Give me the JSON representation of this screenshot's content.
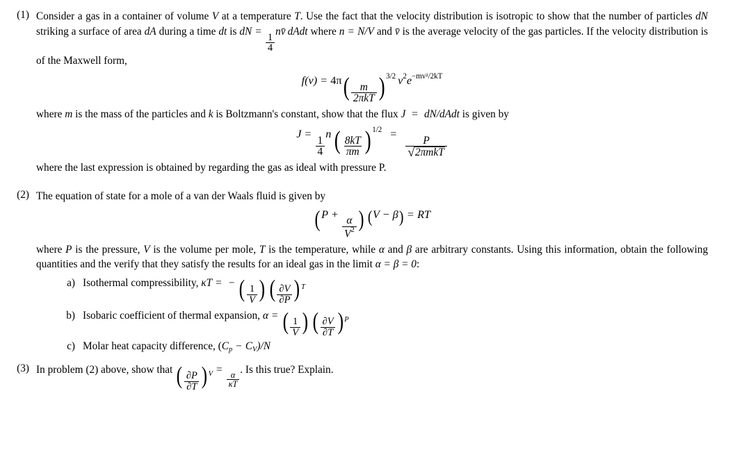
{
  "document": {
    "type": "physics-problem-set",
    "background_color": "#ffffff",
    "text_color": "#000000"
  },
  "problems": [
    {
      "number": "(1)",
      "paragraph1_part1": "Consider a gas in a container of volume",
      "v_symbol": "V",
      "paragraph1_part2": "at a temperature",
      "t_symbol": "T",
      "paragraph1_part3": ". Use the fact that the velocity distribution is isotropic to show that the number of particles",
      "dn_symbol": "dN",
      "paragraph1_part4": "striking a surface of area",
      "da_symbol": "dA",
      "paragraph1_part5": "during a time",
      "dt_symbol": "dt",
      "paragraph1_part6": "is",
      "eq_dn_lhs": "dN",
      "eq_dn_frac_num": "1",
      "eq_dn_frac_den": "4",
      "eq_dn_rhs": "n",
      "eq_dn_vbar": "v̄",
      "eq_dn_tail": "dAdt",
      "paragraph1_part7": "where",
      "n_symbol": "n",
      "n_value": "N/V",
      "paragraph1_part8": "and",
      "vbar_symbol": "v̄",
      "paragraph1_part9": "is the average velocity of the gas particles. If the velocity distribution is of the Maxwell form,",
      "maxwell_eq": {
        "lhs": "f(v)",
        "coefficient": "4π",
        "frac_num": "m",
        "frac_den": "2πkT",
        "exponent": "3/2",
        "v_squared": "v",
        "v_sq_exp": "2",
        "exp_base": "e",
        "exp_arg": "−mv²/2kT"
      },
      "paragraph2_part1": "where",
      "m_symbol": "m",
      "paragraph2_part2": "is the mass of the particles and",
      "k_symbol": "k",
      "paragraph2_part3": "is Boltzmann's constant, show that the flux",
      "j_symbol": "J",
      "j_value": "dN/dAdt",
      "paragraph2_part4": "is given by",
      "flux_eq": {
        "lhs": "J",
        "frac_num": "1",
        "frac_den": "4",
        "n": "n",
        "paren_num": "8kT",
        "paren_den": "πm",
        "exponent": "1/2",
        "rhs_num": "P",
        "rhs_den": "2πmkT"
      },
      "paragraph3": "where the last expression is obtained by regarding the gas as ideal with pressure P."
    },
    {
      "number": "(2)",
      "intro": "The equation of state for a mole of a van der Waals fluid is given by",
      "vdw_eq": {
        "p": "P",
        "plus": "+",
        "frac_num": "α",
        "frac_den": "V",
        "frac_den_exp": "2",
        "v_minus_beta": "V − β",
        "equals": "=",
        "rt": "RT"
      },
      "paragraph_part1": "where",
      "p_symbol": "P",
      "paragraph_part2": "is the pressure,",
      "v_symbol": "V",
      "paragraph_part3": "is the volume per mole,",
      "t_symbol": "T",
      "paragraph_part4": "is the temperature, while",
      "alpha_symbol": "α",
      "paragraph_part5": "and",
      "beta_symbol": "β",
      "paragraph_part6": "are arbitrary constants. Using this information, obtain the following quantities and the verify that they satisfy the results for an ideal gas in the limit",
      "limit_condition": "α = β = 0",
      "paragraph_part7": ":",
      "subitems": [
        {
          "label": "a)",
          "text": "Isothermal compressibility,",
          "symbol": "κT",
          "equals": "=",
          "sign": "−",
          "frac1_num": "1",
          "frac1_den": "V",
          "frac2_num": "∂V",
          "frac2_den": "∂P",
          "subscript": "T"
        },
        {
          "label": "b)",
          "text": "Isobaric coefficient of thermal expansion,",
          "symbol": "α",
          "equals": "=",
          "sign": "",
          "frac1_num": "1",
          "frac1_den": "V",
          "frac2_num": "∂V",
          "frac2_den": "∂T",
          "subscript": "P"
        },
        {
          "label": "c)",
          "text": "Molar heat capacity difference,",
          "expr_open": "(",
          "cp": "C",
          "cp_sub": "p",
          "minus": "−",
          "cv": "C",
          "cv_sub": "V",
          "expr_close": ")/N"
        }
      ]
    },
    {
      "number": "(3)",
      "text_part1": "In problem (2) above, show that",
      "eq": {
        "frac_num": "∂P",
        "frac_den": "∂T",
        "subscript": "V",
        "equals": "=",
        "rhs_num": "α",
        "rhs_den": "κT",
        "period": "."
      },
      "text_part2": "Is this true? Explain."
    }
  ]
}
